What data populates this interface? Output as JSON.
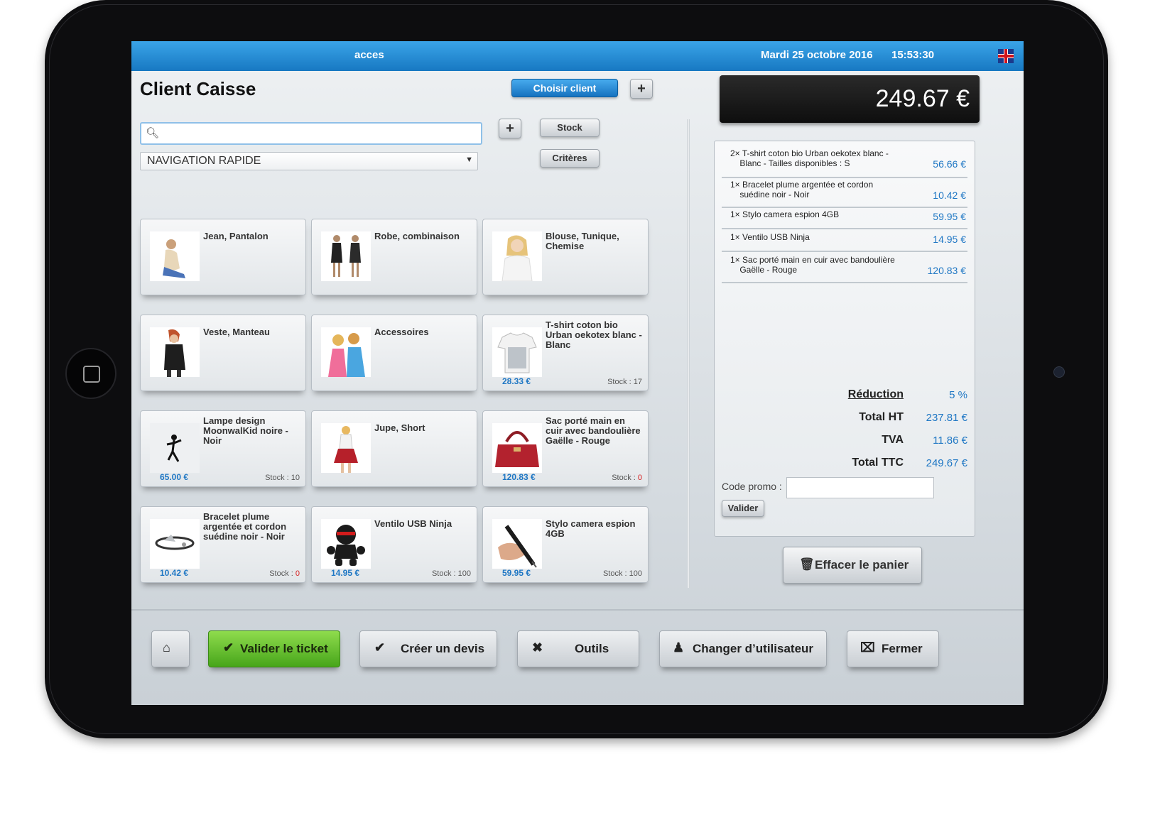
{
  "topbar": {
    "user": "acces",
    "date": "Mardi 25 octobre 2016",
    "time": "15:53:30",
    "language_flag": "uk-flag-icon"
  },
  "header": {
    "title": "Client Caisse",
    "choose_client": "Choisir client",
    "add": "+"
  },
  "search": {
    "value": "",
    "placeholder": ""
  },
  "toolbar": {
    "add": "+",
    "stock": "Stock",
    "criteria": "Critères"
  },
  "navigation": {
    "selected": "NAVIGATION RAPIDE"
  },
  "tiles": [
    {
      "name": "Jean, Pantalon",
      "price": "",
      "stock_label": "",
      "stock_value": ""
    },
    {
      "name": "Robe, combinaison",
      "price": "",
      "stock_label": "",
      "stock_value": ""
    },
    {
      "name": "Blouse, Tunique, Chemise",
      "price": "",
      "stock_label": "",
      "stock_value": ""
    },
    {
      "name": "Veste, Manteau",
      "price": "",
      "stock_label": "",
      "stock_value": ""
    },
    {
      "name": "Accessoires",
      "price": "",
      "stock_label": "",
      "stock_value": ""
    },
    {
      "name": "T-shirt coton bio Urban oekotex blanc - Blanc",
      "price": "28.33 €",
      "stock_label": "Stock : ",
      "stock_value": "17"
    },
    {
      "name": "Lampe design MoonwalKid noire - Noir",
      "price": "65.00 €",
      "stock_label": "Stock : ",
      "stock_value": "10"
    },
    {
      "name": "Jupe, Short",
      "price": "",
      "stock_label": "",
      "stock_value": ""
    },
    {
      "name": "Sac porté main en cuir avec bandoulière Gaëlle - Rouge",
      "price": "120.83 €",
      "stock_label": "Stock : ",
      "stock_value": "0"
    },
    {
      "name": "Bracelet plume argentée et cordon suédine noir - Noir",
      "price": "10.42 €",
      "stock_label": "Stock : ",
      "stock_value": "0"
    },
    {
      "name": "Ventilo USB Ninja",
      "price": "14.95 €",
      "stock_label": "Stock : ",
      "stock_value": "100"
    },
    {
      "name": "Stylo camera espion 4GB",
      "price": "59.95 €",
      "stock_label": "Stock : ",
      "stock_value": "100"
    }
  ],
  "total": {
    "display": "249.67 €"
  },
  "cart": [
    {
      "qty": "2×",
      "line1": "T-shirt coton bio Urban oekotex blanc -",
      "line2": "Blanc - Tailles disponibles : S",
      "amount": "56.66 €"
    },
    {
      "qty": "1×",
      "line1": "Bracelet plume argentée et cordon",
      "line2": "suédine noir - Noir",
      "amount": "10.42 €"
    },
    {
      "qty": "1×",
      "line1": "Stylo camera espion 4GB",
      "line2": "",
      "amount": "59.95 €"
    },
    {
      "qty": "1×",
      "line1": "Ventilo USB Ninja",
      "line2": "",
      "amount": "14.95 €"
    },
    {
      "qty": "1×",
      "line1": "Sac porté main en cuir avec bandoulière",
      "line2": "Gaëlle - Rouge",
      "amount": "120.83 €"
    }
  ],
  "summary": {
    "reduction_label": "Réduction",
    "reduction_value": "5 %",
    "total_ht_label": "Total HT",
    "total_ht_value": "237.81 €",
    "tva_label": "TVA",
    "tva_value": "11.86 €",
    "total_ttc_label": "Total TTC",
    "total_ttc_value": "249.67 €"
  },
  "promo": {
    "label": "Code promo :",
    "value": "",
    "validate": "Valider"
  },
  "clear_cart": "Effacer le panier",
  "bottom_bar": {
    "home_icon": "home-icon",
    "validate_ticket": "Valider le ticket",
    "create_quote": "Créer un devis",
    "tools": "Outils",
    "change_user": "Changer d’utilisateur",
    "close": "Fermer"
  },
  "colors": {
    "accent_blue": "#1f77c4",
    "topbar": "#1778c2",
    "valid_green": "#47a51a",
    "stock_zero": "#d62020"
  }
}
